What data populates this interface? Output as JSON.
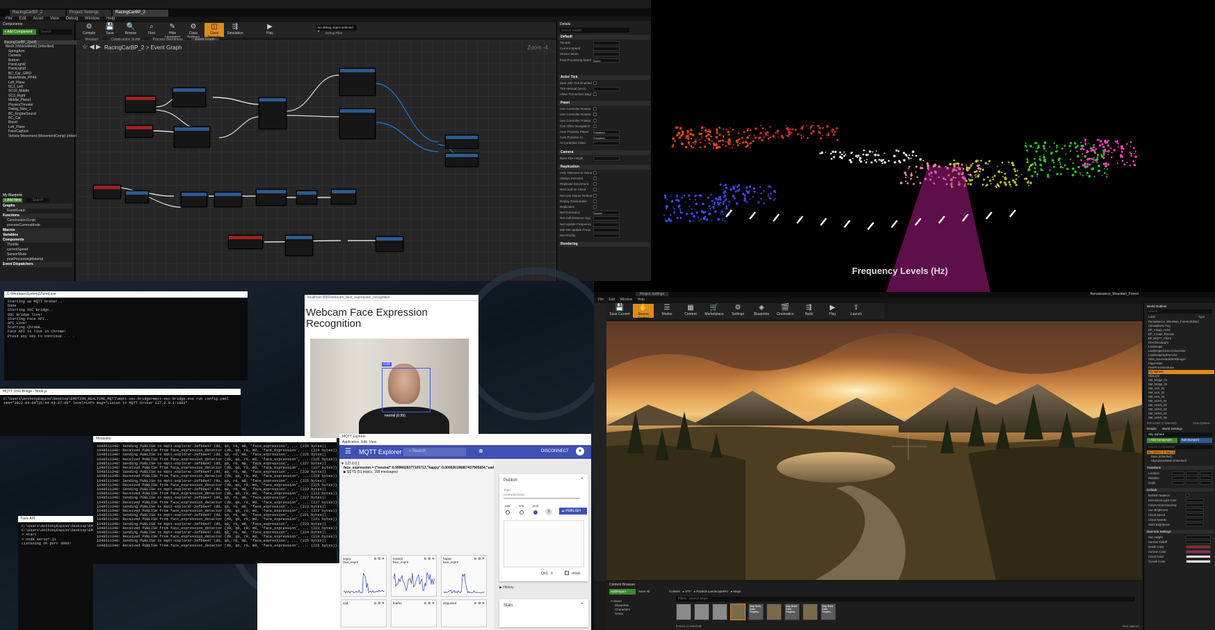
{
  "ue_blueprint": {
    "tabs": [
      "RacingCarBP_2",
      "Project Settings",
      "RacingCarBP_2"
    ],
    "menu": [
      "File",
      "Edit",
      "Asset",
      "View",
      "Debug",
      "Window",
      "Help"
    ],
    "components_label": "Components",
    "add_component": "+ Add Component",
    "search_placeholder": "Search",
    "component_tree": [
      "RacingCarBP_2(self)",
      "Mesh (VehicleMesh) (Inherited)",
      "SpringArm",
      "Camera",
      "Bottom",
      "PointLight2",
      "PointLight3",
      "BC_Car_GRID",
      "MotorMode_PP4K",
      "Left_Plane",
      "SC1_Left",
      "SC10_Middle",
      "SC3_Right",
      "Middle_Plane1",
      "PhysicsThruster",
      "Dialog_New_1",
      "BC_EngineSound",
      "BC_Car",
      "Boost",
      "Left_Plane",
      "FaceCapture",
      "Vehicle Movement (MovementComp) (Inherit"
    ],
    "toolbar": [
      {
        "icon": "⚙",
        "label": "Compile"
      },
      {
        "icon": "💾",
        "label": "Save"
      },
      {
        "icon": "🔍",
        "label": "Browse"
      },
      {
        "icon": "⌕",
        "label": "Find"
      },
      {
        "icon": "✎",
        "label": "Hide Unrelated"
      },
      {
        "icon": "⚙",
        "label": "Class Settings"
      },
      {
        "icon": "◫",
        "label": "Class Defaults"
      },
      {
        "icon": "⇶",
        "label": "Simulation"
      },
      {
        "icon": "▶",
        "label": "Play"
      }
    ],
    "debug_selector": "No debug object selected ▾",
    "debug_filter": "Debug Filter",
    "graph_tabs": [
      "Viewport",
      "Construction Script",
      "Process Brightness",
      "Event Graph"
    ],
    "breadcrumb": "RacingCarBP_2 > Event Graph",
    "zoom": "Zoom -4",
    "mybp": {
      "header": "My Blueprint",
      "add_new": "+ Add New",
      "search": "Search",
      "sections": [
        "Graphs",
        "EventGraph",
        "Functions",
        "ConstructionScript",
        "processCameraMode",
        "Macros",
        "Variables",
        "Components",
        "Throttle",
        "currentSpeed",
        "SensorMode",
        "postProcessingMaterial",
        "Event Dispatchers"
      ]
    },
    "details": {
      "header": "Details",
      "search": "Search Details",
      "sections": [
        {
          "title": "Default",
          "rows": [
            "Throttle",
            "Current Speed",
            "Sensor Mode",
            "Post Processing Mater"
          ]
        },
        {
          "title": "Actor Tick",
          "rows": [
            "Start with Tick Enabled",
            "Tick Interval (secs)",
            "Allow Tick Before Begi"
          ]
        },
        {
          "title": "Pawn",
          "rows": [
            "Use Controller Rotatio",
            "Use Controller Rotatio",
            "Use Controller Rotatio",
            "Can Affect Navigation",
            "Auto Possess Player",
            "Auto Possess AI",
            "AI Controller Class"
          ]
        },
        {
          "title": "Camera",
          "rows": [
            "Base Eye Height"
          ]
        },
        {
          "title": "Replication",
          "rows": [
            "Only Relevant to Owne",
            "Always Relevant",
            "Replicate Movement",
            "Net Load on Client",
            "Net Use Owner Releva",
            "Replay Rewindable",
            "Replicates",
            "Net Dormancy",
            "Net Cull Distance Squ",
            "Net Update Frequency",
            "Min Net Update Frequ",
            "Net Priority"
          ]
        },
        {
          "title": "Rendering",
          "rows": []
        }
      ],
      "post_processing": "None",
      "auto_possess_player": "Disabled",
      "auto_possess_ai": "Disabled",
      "net_dormancy": "Awake"
    }
  },
  "viz": {
    "label": "Frequency Levels (Hz)"
  },
  "consoles": {
    "c1": {
      "title": "C:\\Windows\\System32\\cmd.exe",
      "lines": [
        "Starting up MQTT broker..",
        "Done",
        "Starting OSC Bridge..",
        "OSC Bridge live!",
        "Starting Face API..",
        "API Live!",
        "Starting Chrome..",
        "Face API is live in Chrome!",
        "Press any key to continue . . ."
      ]
    },
    "c2": {
      "title": "MQTT OSC Bridge - Node.js",
      "lines": [
        "C:\\Users\\AnthonyEspino\\Desktop\\EMOTION_REALTIME_MQTT\\mqtt-osc-bridge>mqtt-osc-bridge.exe run config.yaml",
        "ime=\"2022-04-04T15:44:49-07:00\" level=info msg=\"Listen to MQTT broker 127.0.0.1:1883\""
      ]
    },
    "c3": {
      "title": "Mosquitto",
      "lines": [
        "1648511340: Sending PUBLISH to mqtt-explorer-2efb9e47 (d0, q0, r0, m0, 'face_expression', ... (226 bytes))",
        "1648511340: Received PUBLISH from face_expression_detector (d0, q0, r0, m0, 'face_expression', ... (226 bytes))",
        "1648511340: Sending PUBLISH to mqtt-explorer-2efb9e47 (d0, q0, r0, m0, 'face_expression', ... (225 bytes))",
        "1648511340: Received PUBLISH from face_expression_detector (d0, q0, r0, m0, 'face_expression', ... (225 bytes))",
        "1648511340: Sending PUBLISH to mqtt-explorer-2efb9e47 (d0, q0, r0, m0, 'face_expression', ... (227 bytes))",
        "1648511340: Received PUBLISH from face_expression_detector (d0, q0, r0, m0, 'face_expression', ... (227 bytes))",
        "1648511340: Sending PUBLISH to mqtt-explorer-2efb9e47 (d0, q0, r0, m0, 'face_expression', ... (228 bytes))",
        "1648511340: Received PUBLISH from face_expression_detector (d0, q0, r0, m0, 'face_expression', ... (228 bytes))",
        "1648511340: Sending PUBLISH to mqtt-explorer-2efb9e47 (d0, q0, r0, m0, 'face_expression', ... (225 bytes))",
        "1648511340: Received PUBLISH from face_expression_detector (d0, q0, r0, m0, 'face_expression', ... (225 bytes))",
        "1648511340: Sending PUBLISH to mqtt-explorer-2efb9e47 (d0, q0, r0, m0, 'face_expression', ... (223 bytes))",
        "1648511340: Received PUBLISH from face_expression_detector (d0, q0, r0, m0, 'face_expression', ... (223 bytes))",
        "1648511340: Sending PUBLISH to mqtt-explorer-2efb9e47 (d0, q0, r0, m0, 'face_expression', ... (227 bytes))",
        "1648511340: Received PUBLISH from face_expression_detector (d0, q0, r0, m0, 'face_expression', ... (227 bytes))",
        "1648511340: Sending PUBLISH to mqtt-explorer-2efb9e47 (d0, q0, r0, m0, 'face_expression', ... (222 bytes))",
        "1648511340: Received PUBLISH from face_expression_detector (d0, q0, r0, m0, 'face_expression', ... (222 bytes))",
        "1648511340: Sending PUBLISH to mqtt-explorer-2efb9e47 (d0, q0, r0, m0, 'face_expression', ... (221 bytes))",
        "1648511340: Received PUBLISH from face_expression_detector (d0, q0, r0, m0, 'face_expression', ... (221 bytes))",
        "1648511340: Sending PUBLISH to mqtt-explorer-2efb9e47 (d0, q0, r0, m0, 'face_expression', ... (223 bytes))",
        "1648511340: Received PUBLISH from face_expression_detector (d0, q0, r0, m0, 'face_expression', ... (223 bytes))",
        "1648511340: Sending PUBLISH to mqtt-explorer-2efb9e47 (d0, q0, r0, m0, 'face_expression', ... (224 bytes))",
        "1648511340: Received PUBLISH from face_expression_detector (d0, q0, r0, m0, 'face_expression', ... (224 bytes))",
        "1648511340: Sending PUBLISH to mqtt-explorer-2efb9e47 (d0, q0, r0, m0, 'face_expression', ... (225 bytes))",
        "1648511340: Received PUBLISH from face_expression_detector (d0, q0, r0, m0, 'face_expression', ... (225 bytes))"
      ]
    },
    "c4": {
      "title": "Face API",
      "lines": [
        "C:\\Users\\AnthonyEspino\\Desktop\\EMOTION",
        "",
        "C:\\Users\\AnthonyEspino\\Desktop\\EMOTION",
        "",
        "> start",
        "> node server.js",
        "",
        "Listening on port 3000!"
      ]
    }
  },
  "webcam": {
    "tab": "localhost:3000/webcam_face_expression_recognition",
    "title": "Webcam Face Expression Recognition",
    "face_tag": "0.99",
    "expression_label": "neutral (0.99)"
  },
  "mqtt": {
    "window_title": "MQTT Explorer",
    "menu": [
      "Application",
      "Edit",
      "View"
    ],
    "app_title": "MQTT Explorer",
    "search_placeholder": "Search",
    "disconnect": "DISCONNECT",
    "tree_root": "▼ 127.0.0.1",
    "tree_line1": "face_expression = {\"neutral\":0.9996626377105713,\"happy\":0.000026196867437905834,\"sad\":0",
    "tree_line2": "▶ $SYS (51 topics, 158 messages)",
    "publish": {
      "title": "Publish",
      "topic_label": "Topic",
      "topic_placeholder": "example/topic",
      "formats": [
        "raw",
        "xml",
        "json"
      ],
      "button": "PUBLISH",
      "qos": "QoS",
      "qos_value": "0",
      "retain": "retain",
      "history": "▶ History"
    },
    "stats": "Stats",
    "charts": [
      {
        "label": "angry face_expre"
      },
      {
        "label": "neutral face_expre"
      },
      {
        "label": "happy face_expre"
      }
    ],
    "charts2": [
      "sad",
      "fearful",
      "disgusted"
    ]
  },
  "ue_landscape": {
    "title": "Project Settings",
    "menu": [
      "File",
      "Edit",
      "Window",
      "Help"
    ],
    "toolbar": [
      {
        "icon": "💾",
        "label": "Save Current"
      },
      {
        "icon": "✋",
        "label": "Source Control"
      },
      {
        "icon": "☰",
        "label": "Modes"
      },
      {
        "icon": "▦",
        "label": "Content"
      },
      {
        "icon": "🛒",
        "label": "Marketplace"
      },
      {
        "icon": "⚙",
        "label": "Settings"
      },
      {
        "icon": "◈",
        "label": "Blueprints"
      },
      {
        "icon": "🎬",
        "label": "Cinematics"
      },
      {
        "icon": "⇶",
        "label": "Build"
      },
      {
        "icon": "▶",
        "label": "Play"
      },
      {
        "icon": "⇪",
        "label": "Launch"
      }
    ],
    "title_right": "Renaissance_Mountain_Forest",
    "content_browser": {
      "tab": "Content Browser",
      "add": "Add/Import",
      "save_all": "Save All",
      "path": [
        "Content",
        "STF",
        "Pack03-LandscapePro",
        "Maps"
      ],
      "filters": "Filters",
      "search": "Search Maps",
      "folders": [
        "Content",
        "Blueprints",
        "Characters",
        "Demo"
      ],
      "assets": [
        "",
        "",
        "",
        "",
        "Map Build Data Registry",
        "",
        "Map Build Data Registry",
        "",
        "Map Build Data Registry"
      ],
      "status": "9 items (1 selected)",
      "view_options": "View Options"
    },
    "outliner": {
      "header": "World Outliner",
      "search": "Search...",
      "col_label": "Label",
      "col_type": "Type",
      "rows": [
        "Renaissance_Mountain_Forest (Editor)",
        "Atmospheric Fog",
        "BP_Amigo_Actor",
        "BP_Create_Remote",
        "BP_MQTT_Client",
        "DirectionalLight",
        "Landscape",
        "LandscapeGizmoActiveActor",
        "LandscapeSplineActor",
        "OBS_SourceBuilderManager",
        "PlayerStart",
        "PostProcessVolume",
        "Sky Sphere",
        "SkyLight",
        "SM_bridge_01",
        "SM_bridge_02",
        "SM_rock_01",
        "SM_rock_02",
        "SM_rock_03",
        "SM_rockG_01",
        "SM_rockG_02",
        "SM_rockG_03",
        "SM_rockG_04",
        "SM_rockG_05"
      ],
      "actor_count": "203 actors (1 selected)",
      "view_options": "View Options"
    },
    "details": {
      "tabs": [
        "Details",
        "World Settings"
      ],
      "selected": "Sky Sphere",
      "add_component": "+ Add Component",
      "edit_blueprint": "Edit Blueprint",
      "search": "Search Components",
      "components": [
        "Sky Sphere (Instance)",
        "Base (Inherited)",
        "SkySphereMesh (Inherited)"
      ],
      "sections": [
        "Transform",
        "Default",
        "Override Settings"
      ],
      "transform": [
        "Location",
        "Rotation",
        "Scale"
      ],
      "default_rows": [
        "Refresh Material",
        "Directional Light Actor",
        "Colors Determined By",
        "Sun Brightness",
        "Cloud Speed",
        "Cloud Opacity",
        "Stars Brightness"
      ],
      "override_rows": [
        "Sun Height",
        "Horizon Falloff",
        "Zenith Color",
        "Horizon Color",
        "Cloud Color",
        "Overall Color"
      ]
    }
  }
}
